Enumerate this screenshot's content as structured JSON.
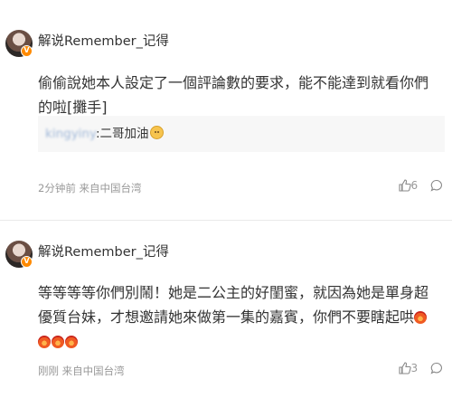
{
  "comments": [
    {
      "username": "解说Remember_记得",
      "text": "偷偷說她本人設定了一個評論數的要求，能不能達到就看你們的啦[攤手]",
      "reply": {
        "user": "kingyiny",
        "text": ":二哥加油"
      },
      "time": "2分钟前 来自中国台湾",
      "likes": "6"
    },
    {
      "username": "解说Remember_记得",
      "text": "等等等等你們別鬧！她是二公主的好閨蜜，就因為她是單身超優質台妹，才想邀請她來做第一集的嘉賓，你們不要瞎起哄",
      "time": "刚刚 来自中国台湾",
      "likes": "3"
    }
  ],
  "icons": {
    "verified": "verified-badge-icon",
    "like": "thumbs-up-icon",
    "comment": "comment-bubble-icon"
  },
  "colors": {
    "verified_badge": "#ff8a00",
    "meta_text": "#999999",
    "reply_bg": "#f7f7f7"
  }
}
